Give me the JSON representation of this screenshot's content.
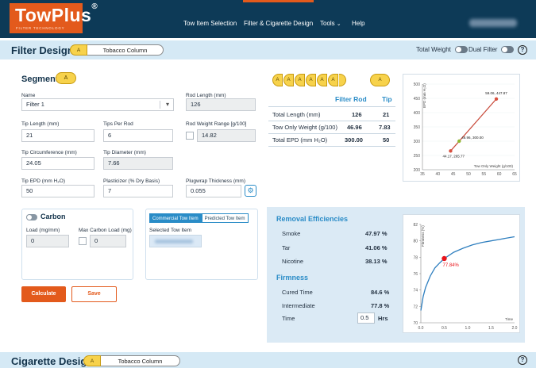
{
  "app": {
    "logo": "TowPlus",
    "logo_reg": "®",
    "logo_sub": "FILTER TECHNOLOGY"
  },
  "nav": {
    "items": [
      "Tow Item Selection",
      "Filter & Cigarette Design",
      "Tools",
      "Help"
    ]
  },
  "filter_design": {
    "title": "Filter Design",
    "segment_tag": "A",
    "column_label": "Tobacco Column",
    "total_weight_label": "Total Weight",
    "dual_filter_label": "Dual Filter",
    "help": "?"
  },
  "segment": {
    "title": "Segment",
    "tag": "A",
    "name_label": "Name",
    "name_value": "Filter 1",
    "rod_length_label": "Rod Length (mm)",
    "rod_length_value": "126",
    "tip_length_label": "Tip Length (mm)",
    "tip_length_value": "21",
    "tips_per_rod_label": "Tips Per Rod",
    "tips_per_rod_value": "6",
    "rod_weight_range_label": "Rod Weight Range [g/100]",
    "rod_weight_range_value": "14.82",
    "tip_circ_label": "Tip Circumference (mm)",
    "tip_circ_value": "24.05",
    "tip_diam_label": "Tip Diameter (mm)",
    "tip_diam_value": "7.66",
    "tip_epd_label": "Tip EPD (mm H₂O)",
    "tip_epd_value": "50",
    "plasticizer_label": "Plasticizer (% Dry Basis)",
    "plasticizer_value": "7",
    "plugwrap_label": "Plugwrap Thickness (mm)",
    "plugwrap_value": "0.055"
  },
  "carbon": {
    "label": "Carbon",
    "load_label": "Load (mg/mm)",
    "load_value": "0",
    "max_load_label": "Max Carbon Load (mg)",
    "max_load_value": "0"
  },
  "tow": {
    "tab_commercial": "Commercial Tow Item",
    "tab_predicted": "Predicted Tow Item",
    "selected_label": "Selected Tow Item"
  },
  "buttons": {
    "calculate": "Calculate",
    "save": "Save"
  },
  "summary": {
    "cig_tags": [
      "A",
      "A",
      "A",
      "A",
      "A",
      "A"
    ],
    "tip_tag": "A",
    "col_filter_rod": "Filter Rod",
    "col_tip": "Tip",
    "rows": [
      {
        "label": "Total Length (mm)",
        "rod": "126",
        "tip": "21"
      },
      {
        "label": "Tow Only Weight (g/100)",
        "rod": "46.96",
        "tip": "7.83"
      },
      {
        "label": "Total EPD (mm H₂O)",
        "rod": "300.00",
        "tip": "50"
      }
    ]
  },
  "removal": {
    "title": "Removal Efficiencies",
    "rows": [
      {
        "label": "Smoke",
        "value": "47.97 %"
      },
      {
        "label": "Tar",
        "value": "41.06 %"
      },
      {
        "label": "Nicotine",
        "value": "38.13 %"
      }
    ]
  },
  "firmness": {
    "title": "Firmness",
    "rows": [
      {
        "label": "Cured Time",
        "value": "84.6 %"
      },
      {
        "label": "Intermediate",
        "value": "77.8 %"
      }
    ],
    "time_label": "Time",
    "time_value": "0.5",
    "time_unit": "Hrs"
  },
  "cigarette_design": {
    "title": "Cigarette Design",
    "segment_tag": "A",
    "column_label": "Tobacco Column",
    "help": "?"
  },
  "chart_data": [
    {
      "type": "line",
      "ylabel": "EPD (mm H₂O)",
      "xlabel": "Tow Only Weight (g/100)",
      "xlim": [
        35,
        65
      ],
      "ylim": [
        200,
        500
      ],
      "xticks": [
        35,
        40,
        45,
        50,
        55,
        60,
        65
      ],
      "yticks": [
        200,
        250,
        300,
        350,
        400,
        450,
        500
      ],
      "points": [
        {
          "x": 44.17,
          "y": 265.77,
          "label": "44.17, 265.77",
          "color": "#d9503f"
        },
        {
          "x": 46.96,
          "y": 300.0,
          "label": "46.96, 300.00",
          "color": "#8fb82e"
        },
        {
          "x": 59.06,
          "y": 447.87,
          "label": "59.06, 447.87",
          "color": "#d9503f"
        }
      ],
      "line_color": "#c84a3a"
    },
    {
      "type": "line",
      "ylabel": "Firmness (%)",
      "xlabel": "Time",
      "xlim": [
        0.0,
        2.0
      ],
      "ylim": [
        70,
        82
      ],
      "xticks": [
        "0.0",
        "0.5",
        "1.0",
        "1.5",
        "2.0"
      ],
      "yticks": [
        70,
        72,
        74,
        76,
        78,
        80,
        82
      ],
      "x": [
        0.0,
        0.05,
        0.1,
        0.2,
        0.3,
        0.4,
        0.5,
        0.7,
        0.9,
        1.1,
        1.3,
        1.5,
        1.7,
        1.9,
        2.0
      ],
      "y": [
        71.5,
        73.2,
        74.3,
        75.7,
        76.7,
        77.3,
        77.84,
        78.6,
        79.1,
        79.5,
        79.8,
        80.0,
        80.2,
        80.4,
        80.5
      ],
      "marker": {
        "x": 0.5,
        "y": 77.84,
        "label": "77.84%",
        "color": "#e8141b"
      },
      "line_color": "#2f7fbf"
    }
  ]
}
